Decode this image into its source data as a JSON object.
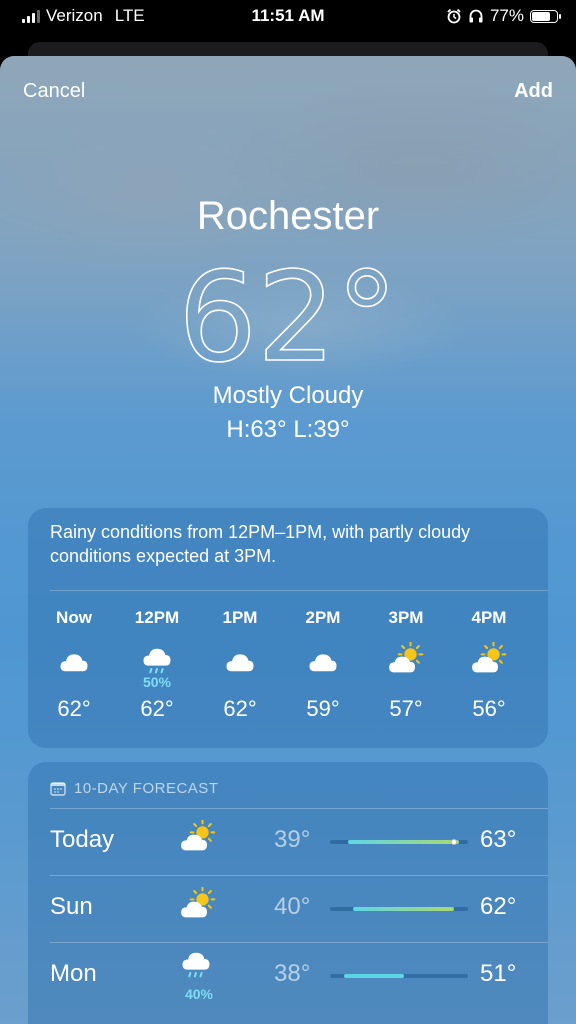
{
  "status_bar": {
    "carrier": "Verizon",
    "network": "LTE",
    "time": "11:51 AM",
    "battery": "77%",
    "battery_level": 0.77,
    "icons": [
      "signal-bars-icon",
      "alarm-icon",
      "headphones-icon",
      "battery-icon"
    ]
  },
  "nav": {
    "cancel_label": "Cancel",
    "add_label": "Add"
  },
  "current": {
    "city": "Rochester",
    "temperature": "62°",
    "condition": "Mostly Cloudy",
    "high_low": "H:63°  L:39°"
  },
  "hourly": {
    "summary": "Rainy conditions from 12PM–1PM, with partly cloudy conditions expected at 3PM.",
    "hours": [
      {
        "label": "Now",
        "icon": "cloud-icon",
        "pop": "",
        "temp": "62°"
      },
      {
        "label": "12PM",
        "icon": "cloud-rain-icon",
        "pop": "50%",
        "temp": "62°"
      },
      {
        "label": "1PM",
        "icon": "cloud-icon",
        "pop": "",
        "temp": "62°"
      },
      {
        "label": "2PM",
        "icon": "cloud-icon",
        "pop": "",
        "temp": "59°"
      },
      {
        "label": "3PM",
        "icon": "partly-sunny-icon",
        "pop": "",
        "temp": "57°"
      },
      {
        "label": "4PM",
        "icon": "partly-sunny-icon",
        "pop": "",
        "temp": "56°"
      }
    ]
  },
  "daily": {
    "header": "10-DAY FORECAST",
    "days": [
      {
        "name": "Today",
        "icon": "partly-sunny-icon",
        "pop": "",
        "low": "39°",
        "high": "63°",
        "range_low": 39,
        "range_high": 63,
        "current": 62,
        "range_colors": [
          "#5fd6e6",
          "#a8d870"
        ]
      },
      {
        "name": "Sun",
        "icon": "partly-sunny-icon",
        "pop": "",
        "low": "40°",
        "high": "62°",
        "range_low": 40,
        "range_high": 62,
        "range_colors": [
          "#5fd6e6",
          "#a8d870"
        ]
      },
      {
        "name": "Mon",
        "icon": "cloud-rain-icon",
        "pop": "40%",
        "low": "38°",
        "high": "51°",
        "range_low": 38,
        "range_high": 51,
        "range_colors": [
          "#5fd6e6",
          "#5fd6e6"
        ]
      }
    ],
    "scale_min": 35,
    "scale_max": 65
  },
  "colors": {
    "precip": "#7fdcf2",
    "sun": "#f5c518"
  }
}
